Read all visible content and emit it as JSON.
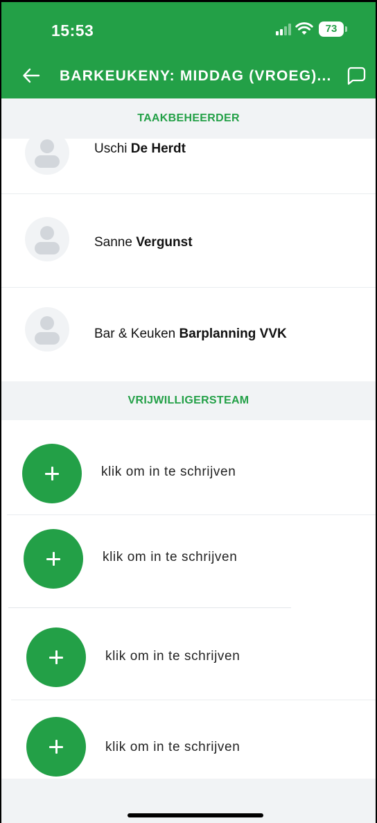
{
  "status_bar": {
    "time": "15:53",
    "battery": "73"
  },
  "header": {
    "title": "BARKEUKENY: MIDDAG (VROEG)..."
  },
  "colors": {
    "accent": "#23a047",
    "band": "#f1f3f5"
  },
  "sections": {
    "manager": "TAAKBEHEERDER",
    "team": "VRIJWILLIGERSTEAM"
  },
  "managers": [
    {
      "first": "Uschi",
      "last": "De Herdt"
    },
    {
      "first": "Sanne",
      "last": "Vergunst"
    },
    {
      "first": "Bar & Keuken",
      "last": "Barplanning VVK"
    }
  ],
  "slots": [
    {
      "label": "klik om in te schrijven"
    },
    {
      "label": "klik om in te schrijven"
    },
    {
      "label": "klik om in te schrijven"
    },
    {
      "label": "klik om in te schrijven"
    }
  ],
  "icons": {
    "back": "arrow-left-icon",
    "chat": "chat-bubble-icon",
    "avatar": "person-placeholder-icon",
    "add": "plus-icon"
  }
}
